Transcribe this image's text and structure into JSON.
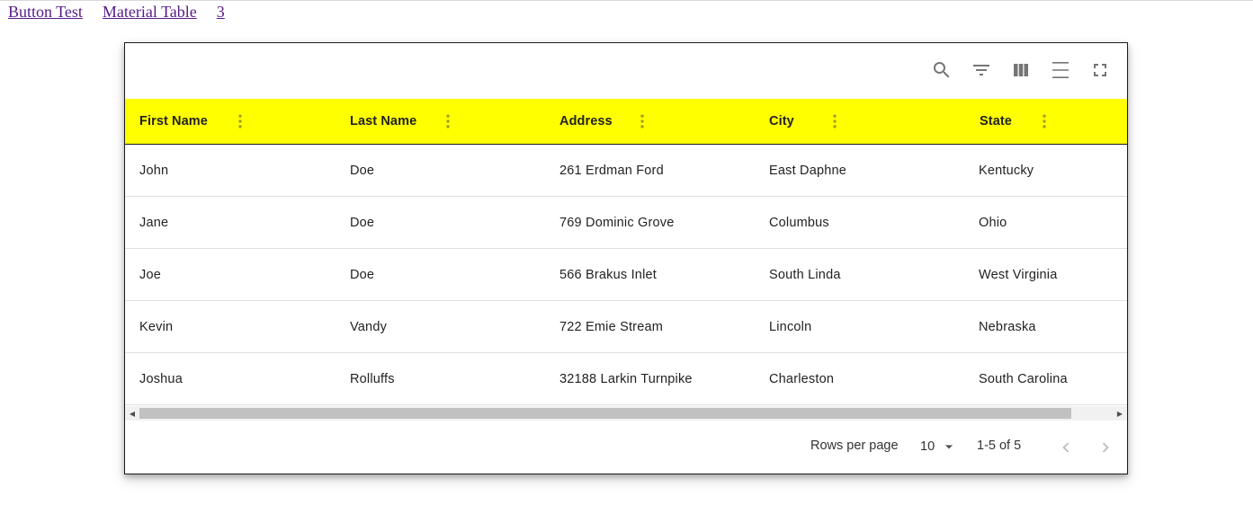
{
  "nav": {
    "links": [
      "Button Test",
      "Material Table",
      "3"
    ]
  },
  "toolbar": {
    "icons": [
      "search-icon",
      "filter-icon",
      "columns-icon",
      "density-icon",
      "fullscreen-icon"
    ]
  },
  "table": {
    "header_color": "#ffff00",
    "columns": [
      "First Name",
      "Last Name",
      "Address",
      "City",
      "State"
    ],
    "rows": [
      [
        "John",
        "Doe",
        "261 Erdman Ford",
        "East Daphne",
        "Kentucky"
      ],
      [
        "Jane",
        "Doe",
        "769 Dominic Grove",
        "Columbus",
        "Ohio"
      ],
      [
        "Joe",
        "Doe",
        "566 Brakus Inlet",
        "South Linda",
        "West Virginia"
      ],
      [
        "Kevin",
        "Vandy",
        "722 Emie Stream",
        "Lincoln",
        "Nebraska"
      ],
      [
        "Joshua",
        "Rolluffs",
        "32188 Larkin Turnpike",
        "Charleston",
        "South Carolina"
      ]
    ]
  },
  "footer": {
    "rows_per_page_label": "Rows per page",
    "rows_per_page_value": "10",
    "range": "1-5 of 5"
  }
}
